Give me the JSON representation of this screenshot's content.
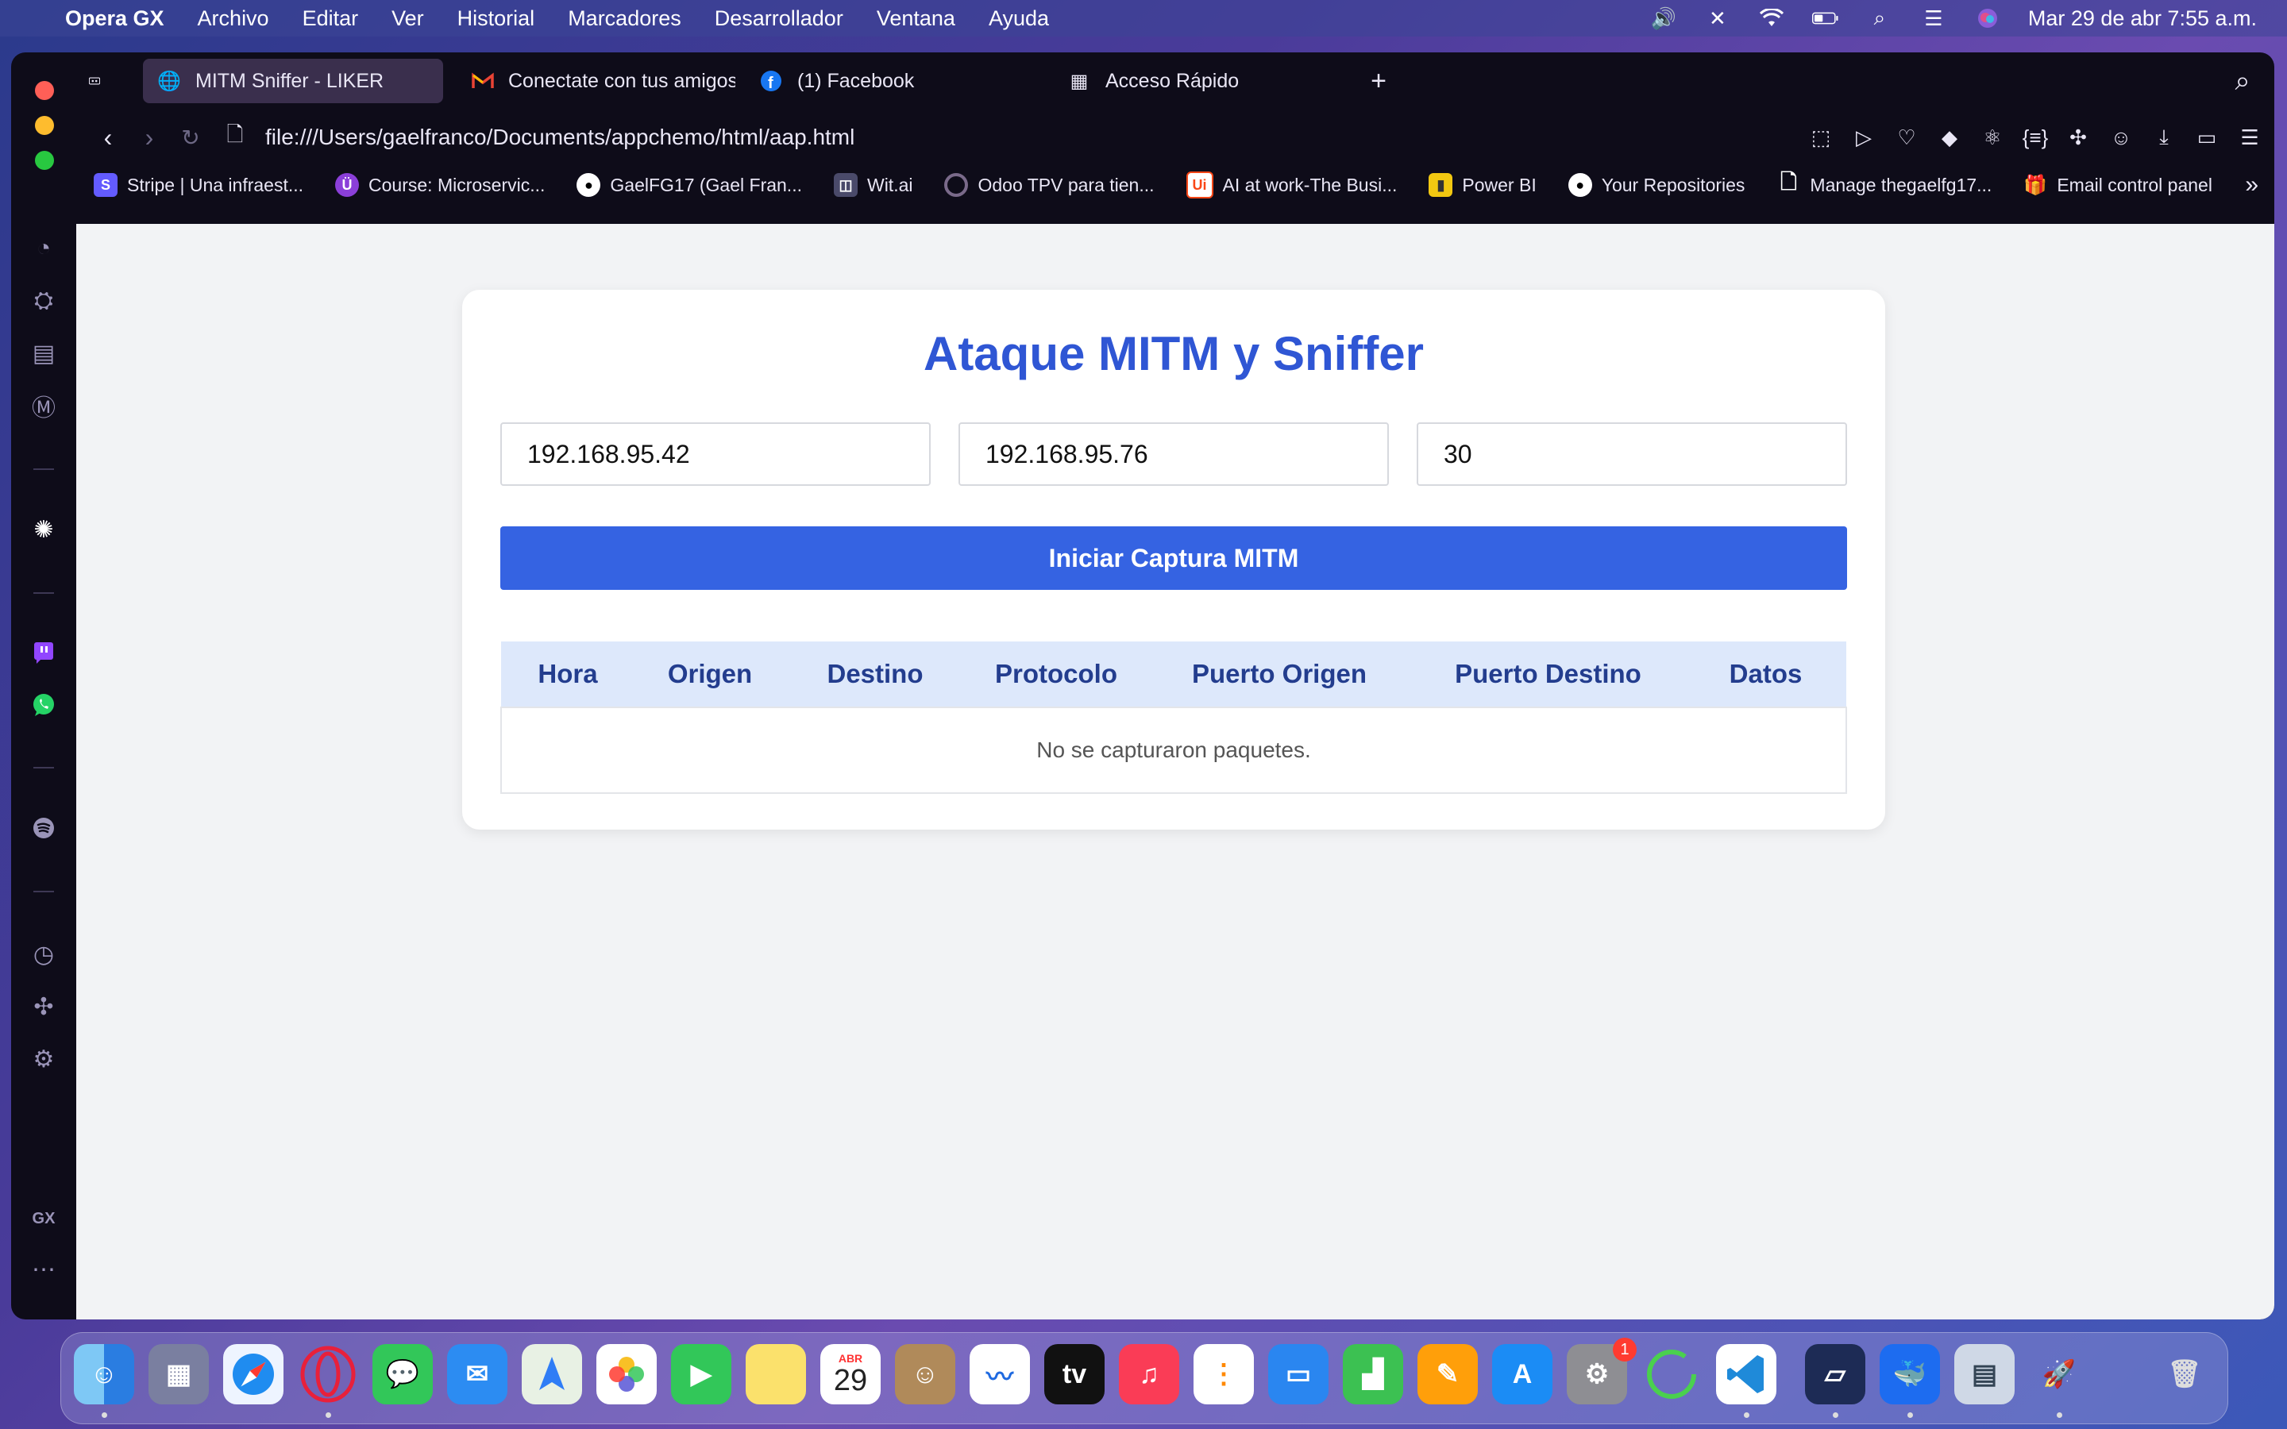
{
  "menubar": {
    "app_name": "Opera GX",
    "items": [
      "Archivo",
      "Editar",
      "Ver",
      "Historial",
      "Marcadores",
      "Desarrollador",
      "Ventana",
      "Ayuda"
    ],
    "clock": "Mar 29 de abr  7:55 a.m."
  },
  "tabs": [
    {
      "label": "MITM Sniffer - LIKER",
      "active": true
    },
    {
      "label": "Conectate con tus amigos",
      "active": false
    },
    {
      "label": "(1) Facebook",
      "active": false
    },
    {
      "label": "Acceso Rápido",
      "active": false
    }
  ],
  "address": {
    "url": "file:///Users/gaelfranco/Documents/appchemo/html/aap.html"
  },
  "bookmarks": [
    "Stripe | Una infraest...",
    "Course: Microservic...",
    "GaelFG17 (Gael Fran...",
    "Wit.ai",
    "Odoo TPV para tien...",
    "AI at work-The Busi...",
    "Power BI",
    "Your Repositories",
    "Manage thegaelfg17...",
    "Email control panel"
  ],
  "sidebar": {
    "gx_label": "GX"
  },
  "main": {
    "title": "Ataque MITM y Sniffer",
    "inputs": {
      "ip_origin": "192.168.95.42",
      "ip_target": "192.168.95.76",
      "duration": "30"
    },
    "start_button": "Iniciar Captura MITM",
    "table": {
      "headers": [
        "Hora",
        "Origen",
        "Destino",
        "Protocolo",
        "Puerto Origen",
        "Puerto Destino",
        "Datos"
      ],
      "empty_message": "No se capturaron paquetes."
    }
  },
  "dock": {
    "calendar_month": "ABR",
    "calendar_day": "29",
    "tv_label": "tv",
    "settings_badge": "1"
  },
  "colors": {
    "accent": "#3563e2",
    "title": "#2f56d4",
    "header_bg": "#dde8fb"
  }
}
